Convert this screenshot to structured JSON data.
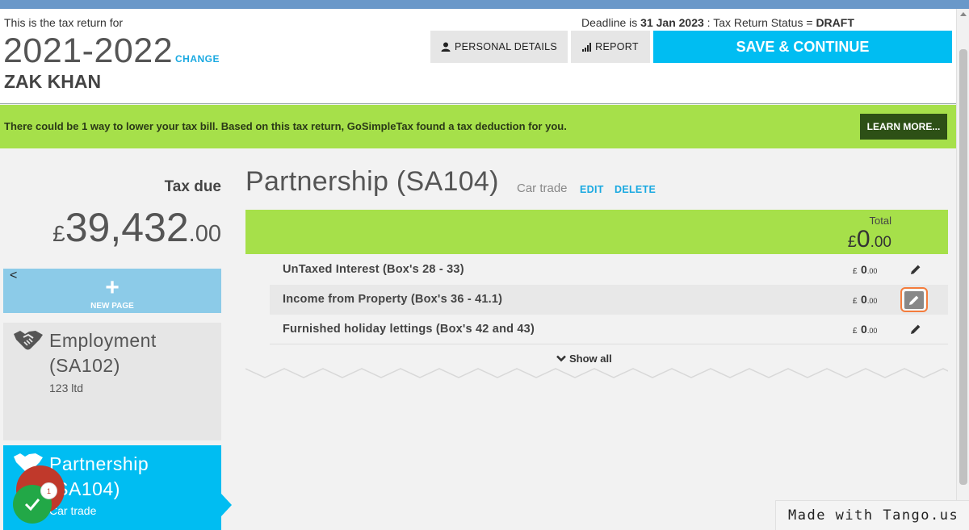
{
  "header": {
    "intro": "This is the tax return for",
    "year": "2021-2022",
    "change_label": "CHANGE",
    "name": "ZAK KHAN",
    "deadline_prefix": "Deadline is ",
    "deadline_date": "31 Jan 2023",
    "status_prefix": " : Tax Return Status = ",
    "status_value": "DRAFT",
    "personal_details_label": "PERSONAL DETAILS",
    "report_label": "REPORT",
    "save_continue_label": "SAVE & CONTINUE"
  },
  "banner": {
    "text": "There could be 1 way to lower your tax bill. Based on this tax return, GoSimpleTax found a tax deduction for you.",
    "learn_more_label": "LEARN MORE..."
  },
  "sidebar": {
    "tax_due_label": "Tax due",
    "tax_due_currency": "£",
    "tax_due_whole": "39,432",
    "tax_due_decimal": ".00",
    "back_glyph": "<",
    "new_page_plus": "+",
    "new_page_label": "NEW PAGE",
    "cards": [
      {
        "title_line1": "Employment",
        "title_line2": "(SA102)",
        "subtitle": "123 ltd",
        "icon": "handshake-icon",
        "active": false
      },
      {
        "title_line1": "Partnership",
        "title_line2": "(SA104)",
        "subtitle": "Car trade",
        "icon": "handshake-icon",
        "active": true
      }
    ],
    "notification_count": "1"
  },
  "main": {
    "title": "Partnership (SA104)",
    "subtitle": "Car trade",
    "edit_label": "EDIT",
    "delete_label": "DELETE",
    "total_label": "Total",
    "total_currency": "£",
    "total_whole": "0",
    "total_decimal": ".00",
    "rows": [
      {
        "name": "UnTaxed Interest (Box's 28 - 33)",
        "currency": "£",
        "whole": "0",
        "decimal": ".00",
        "highlighted": false
      },
      {
        "name": "Income from Property (Box's 36 - 41.1)",
        "currency": "£",
        "whole": "0",
        "decimal": ".00",
        "highlighted": true
      },
      {
        "name": "Furnished holiday lettings (Box's 42 and 43)",
        "currency": "£",
        "whole": "0",
        "decimal": ".00",
        "highlighted": false
      }
    ],
    "show_all_label": "Show all"
  },
  "watermark": "Made with Tango.us",
  "colors": {
    "accent_blue": "#00bdf2",
    "banner_green": "#a6e04a",
    "learn_more_dark_green": "#2d5016",
    "highlight_orange": "#f47c3c",
    "link_blue": "#1aa9e1"
  }
}
